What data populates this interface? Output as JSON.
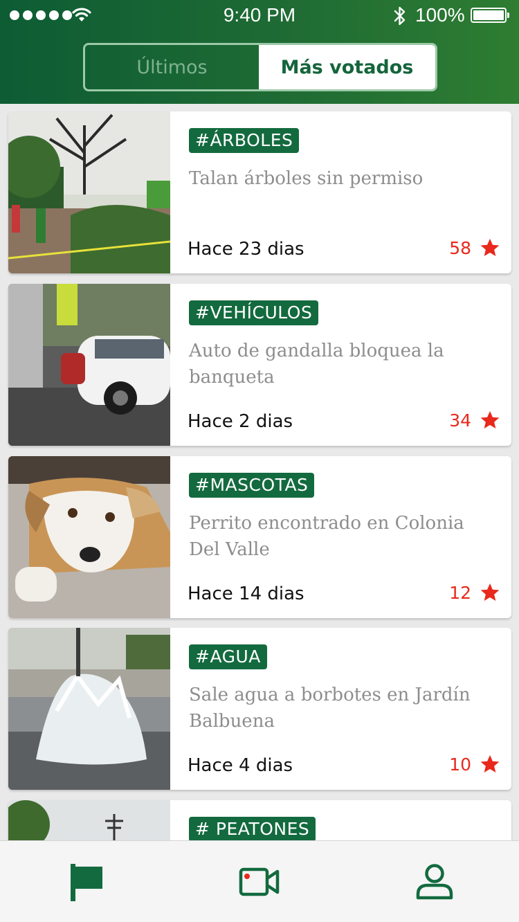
{
  "status_bar": {
    "time": "9:40 PM",
    "battery": "100%",
    "icons": [
      "signal-dots-icon",
      "wifi-icon",
      "bluetooth-icon",
      "battery-icon"
    ]
  },
  "segmented_control": {
    "tabs": [
      {
        "label": "Últimos",
        "selected": false
      },
      {
        "label": "Más votados",
        "selected": true
      }
    ]
  },
  "feed": {
    "items": [
      {
        "tag": "#ÁRBOLES",
        "title": "Talan árboles sin permiso",
        "age": "Hace 23 dias",
        "votes": "58",
        "image": "trees-photo"
      },
      {
        "tag": "#VEHÍCULOS",
        "title": "Auto de gandalla bloquea la banqueta",
        "age": "Hace 2 dias",
        "votes": "34",
        "image": "car-photo"
      },
      {
        "tag": "#MASCOTAS",
        "title": "Perrito encontrado en Colonia Del Valle",
        "age": "Hace 14 dias",
        "votes": "12",
        "image": "dog-photo"
      },
      {
        "tag": "#AGUA",
        "title": "Sale agua a borbotes en Jardín Balbuena",
        "age": "Hace 4 dias",
        "votes": "10",
        "image": "water-photo"
      },
      {
        "tag": "# PEATONES",
        "image": "street-photo"
      }
    ]
  },
  "tab_bar": {
    "items": [
      {
        "icon": "flag-icon",
        "active": true
      },
      {
        "icon": "video-camera-icon",
        "active": false
      },
      {
        "icon": "user-profile-icon",
        "active": false
      }
    ]
  },
  "colors": {
    "brand_green": "#136a3f",
    "header_gradient_start": "#0d5c34",
    "header_gradient_end": "#2e7d32",
    "vote_red": "#e8291c",
    "title_gray": "#8d8d8d"
  }
}
